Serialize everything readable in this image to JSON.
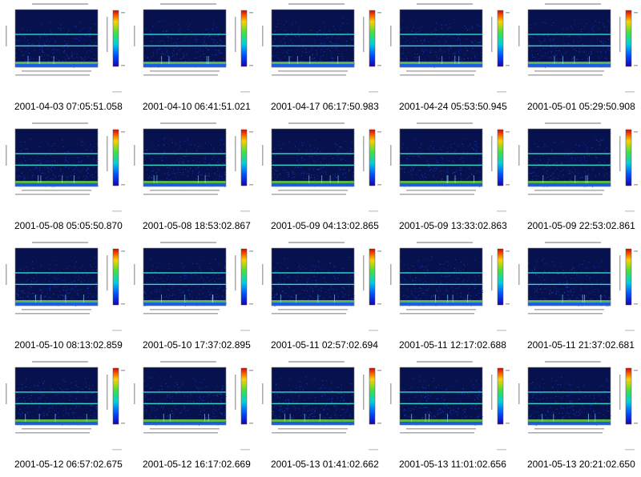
{
  "frames": [
    {
      "caption": "2001-04-03 07:05:51.058"
    },
    {
      "caption": "2001-04-10 06:41:51.021"
    },
    {
      "caption": "2001-04-17 06:17:50.983"
    },
    {
      "caption": "2001-04-24 05:53:50.945"
    },
    {
      "caption": "2001-05-01 05:29:50.908"
    },
    {
      "caption": "2001-05-08 05:05:50.870"
    },
    {
      "caption": "2001-05-08 18:53:02.867"
    },
    {
      "caption": "2001-05-09 04:13:02.865"
    },
    {
      "caption": "2001-05-09 13:33:02.863"
    },
    {
      "caption": "2001-05-09 22:53:02.861"
    },
    {
      "caption": "2001-05-10 08:13:02.859"
    },
    {
      "caption": "2001-05-10 17:37:02.895"
    },
    {
      "caption": "2001-05-11 02:57:02.694"
    },
    {
      "caption": "2001-05-11 12:17:02.688"
    },
    {
      "caption": "2001-05-11 21:37:02.681"
    },
    {
      "caption": "2001-05-12 06:57:02.675"
    },
    {
      "caption": "2001-05-12 16:17:02.669"
    },
    {
      "caption": "2001-05-13 01:41:02.662"
    },
    {
      "caption": "2001-05-13 11:01:02.656"
    },
    {
      "caption": "2001-05-13 20:21:02.650"
    }
  ],
  "colors": {
    "background": "#ffffff",
    "plot_bg": "#06114e",
    "noise": "#1b46d6",
    "band": "#2fd7c8",
    "low_band": "#6ad44a"
  }
}
